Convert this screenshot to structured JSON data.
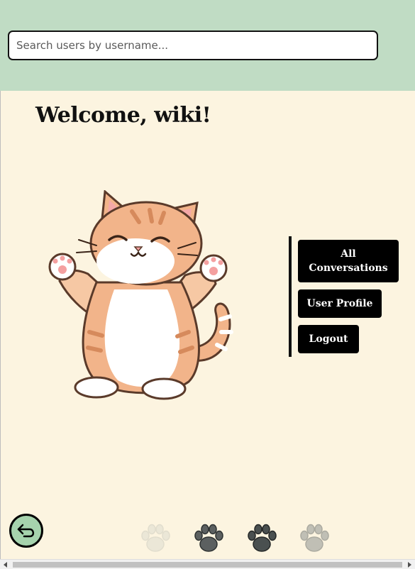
{
  "search": {
    "placeholder": "Search users by username..."
  },
  "welcome": {
    "text": "Welcome, wiki!"
  },
  "illustration": {
    "subject": "cheering orange tabby cat",
    "icon": "cat-illustration"
  },
  "menu": {
    "items": [
      {
        "label": "All Conversations"
      },
      {
        "label": "User Profile"
      },
      {
        "label": "Logout"
      }
    ]
  },
  "footer": {
    "back_icon": "return-arrow-icon",
    "paws": [
      {
        "icon": "paw-icon",
        "color": "#dcdcd0",
        "opacity": 0.5
      },
      {
        "icon": "paw-icon",
        "color": "#5c6060",
        "opacity": 1
      },
      {
        "icon": "paw-icon",
        "color": "#4a5050",
        "opacity": 1
      },
      {
        "icon": "paw-icon",
        "color": "#a8aaa4",
        "opacity": 0.7
      }
    ]
  },
  "colors": {
    "header_bg": "#c0dcc4",
    "page_bg": "#fcf4e0",
    "button_bg": "#000000",
    "back_button_bg": "#a6d3ad"
  }
}
